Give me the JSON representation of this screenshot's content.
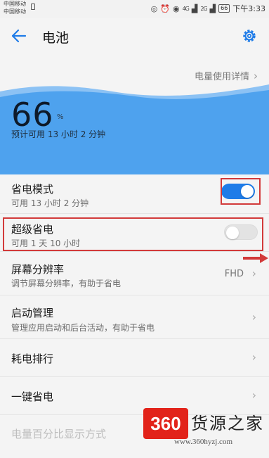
{
  "status_bar": {
    "carrier1": "中国移动",
    "carrier2": "中国移动",
    "signal1": "4G",
    "signal2": "2G",
    "battery": "66",
    "time": "下午3:33"
  },
  "header": {
    "title": "电池",
    "back_icon": "arrow-left-icon",
    "settings_icon": "gear-icon"
  },
  "usage_detail_link": "电量使用详情",
  "battery": {
    "percent": "66",
    "unit": "%",
    "estimate": "预计可用 13 小时 2 分钟",
    "level": 0.66
  },
  "items": [
    {
      "label": "省电模式",
      "sub": "可用 13 小时 2 分钟",
      "toggle": true
    },
    {
      "label": "超级省电",
      "sub": "可用 1 天 10 小时",
      "toggle": false
    },
    {
      "label": "屏幕分辨率",
      "sub": "调节屏幕分辨率，有助于省电",
      "value": "FHD"
    },
    {
      "label": "启动管理",
      "sub": "管理应用启动和后台活动，有助于省电"
    },
    {
      "label": "耗电排行"
    },
    {
      "label": "一键省电"
    },
    {
      "label": "电量百分比显示方式"
    }
  ],
  "watermark": {
    "badge": "360",
    "title": "货源之家",
    "url": "www.360hyzj.com"
  },
  "colors": {
    "accent": "#1f7ce8",
    "highlight": "#d23a3a",
    "hero_blue": "#4ea2ee"
  }
}
